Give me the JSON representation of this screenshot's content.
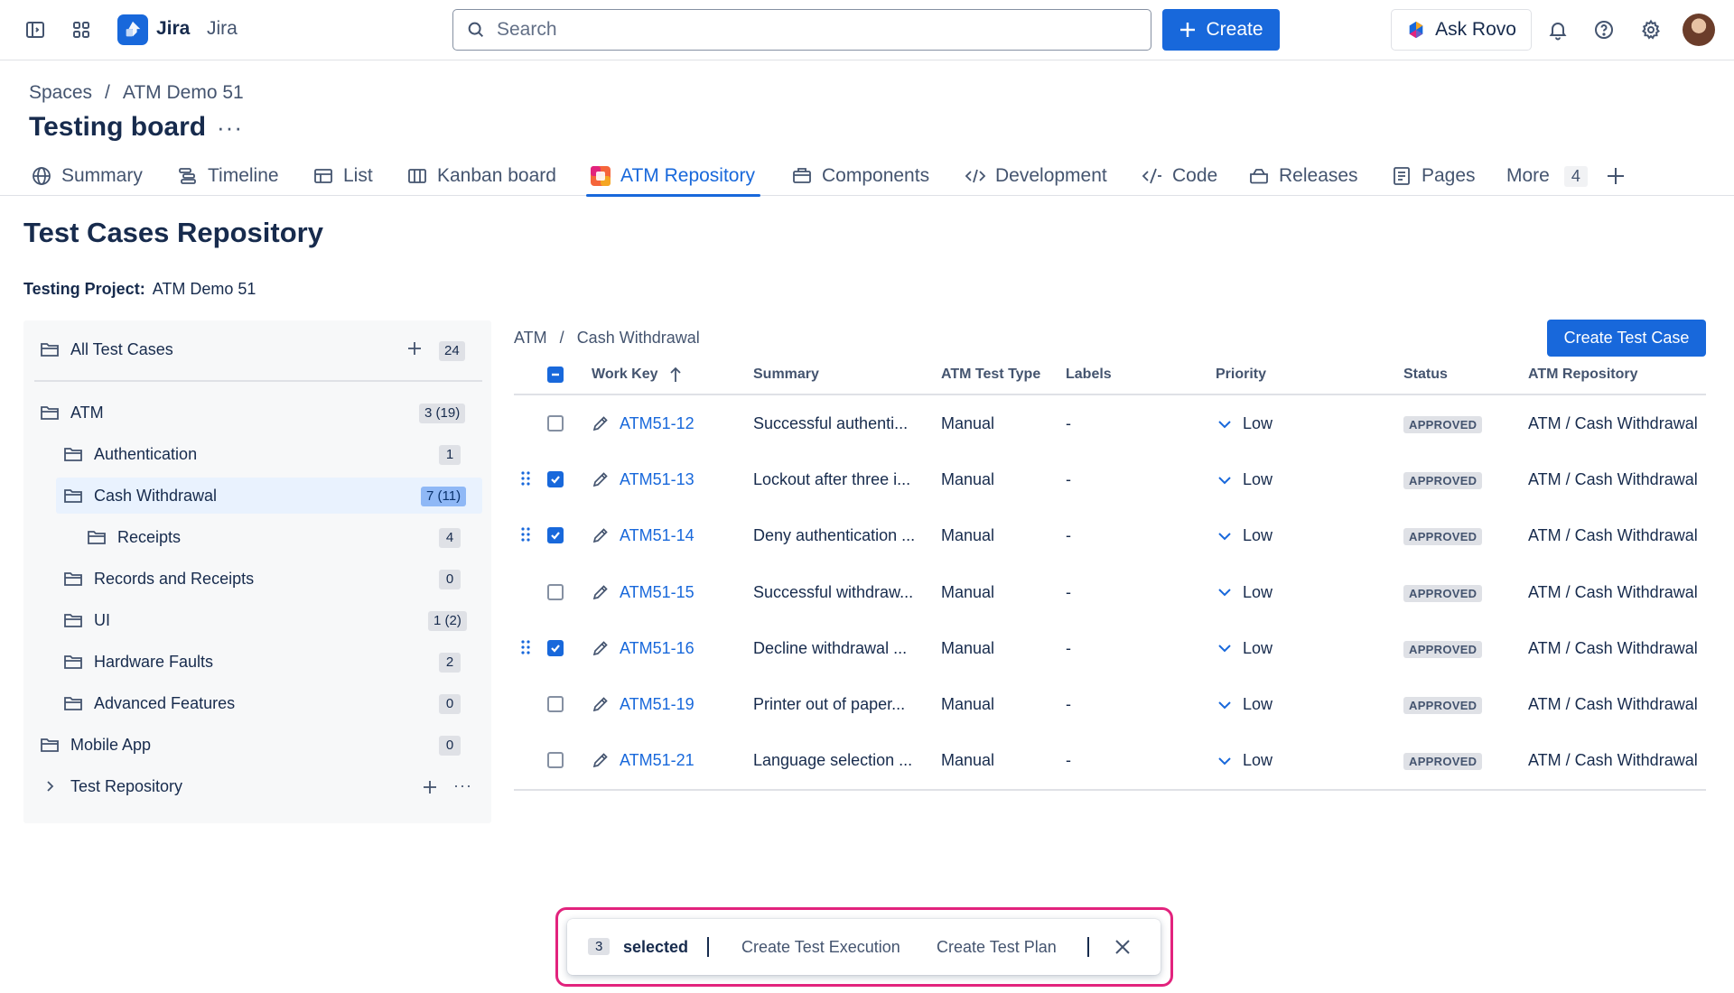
{
  "app": {
    "name": "Jira",
    "workspace": "Jira"
  },
  "search": {
    "placeholder": "Search"
  },
  "topbar": {
    "create_label": "Create",
    "ask_rovo_label": "Ask Rovo"
  },
  "breadcrumb": {
    "items": [
      "Spaces",
      "/",
      "ATM Demo 51"
    ]
  },
  "page": {
    "title": "Testing board",
    "more": "···"
  },
  "tabs": [
    {
      "label": "Summary",
      "icon": "globe-icon"
    },
    {
      "label": "Timeline",
      "icon": "timeline-icon"
    },
    {
      "label": "List",
      "icon": "list-icon"
    },
    {
      "label": "Kanban board",
      "icon": "board-icon"
    },
    {
      "label": "ATM Repository",
      "icon": "atm-app-icon",
      "active": true
    },
    {
      "label": "Components",
      "icon": "components-icon"
    },
    {
      "label": "Development",
      "icon": "development-icon"
    },
    {
      "label": "Code",
      "icon": "code-icon"
    },
    {
      "label": "Releases",
      "icon": "releases-icon"
    },
    {
      "label": "Pages",
      "icon": "pages-icon"
    },
    {
      "label": "More",
      "count": "4"
    }
  ],
  "repository": {
    "title": "Test Cases Repository",
    "project_label": "Testing Project:",
    "project_value": "ATM Demo 51"
  },
  "tree": {
    "all": {
      "label": "All Test Cases",
      "count": "24"
    },
    "items": [
      {
        "label": "ATM",
        "count": "3 (19)"
      },
      {
        "label": "Authentication",
        "count": "1"
      },
      {
        "label": "Cash Withdrawal",
        "count": "7 (11)",
        "selected": true
      },
      {
        "label": "Receipts",
        "count": "4"
      },
      {
        "label": "Records and Receipts",
        "count": "0"
      },
      {
        "label": "UI",
        "count": "1 (2)"
      },
      {
        "label": "Hardware Faults",
        "count": "2"
      },
      {
        "label": "Advanced Features",
        "count": "0"
      },
      {
        "label": "Mobile App",
        "count": "0"
      }
    ],
    "test_repository": "Test Repository"
  },
  "table": {
    "breadcrumb": [
      "ATM",
      "/",
      "Cash Withdrawal"
    ],
    "create_button": "Create Test Case",
    "columns": [
      "Work Key",
      "Summary",
      "ATM Test Type",
      "Labels",
      "Priority",
      "Status",
      "ATM Repository"
    ],
    "rows": [
      {
        "key": "ATM51-12",
        "summary": "Successful authenti...",
        "type": "Manual",
        "labels": "-",
        "priority": "Low",
        "status": "APPROVED",
        "repo": "ATM / Cash Withdrawal",
        "checked": false
      },
      {
        "key": "ATM51-13",
        "summary": "Lockout after three i...",
        "type": "Manual",
        "labels": "-",
        "priority": "Low",
        "status": "APPROVED",
        "repo": "ATM / Cash Withdrawal",
        "checked": true
      },
      {
        "key": "ATM51-14",
        "summary": "Deny authentication ...",
        "type": "Manual",
        "labels": "-",
        "priority": "Low",
        "status": "APPROVED",
        "repo": "ATM / Cash Withdrawal",
        "checked": true
      },
      {
        "key": "ATM51-15",
        "summary": "Successful withdraw...",
        "type": "Manual",
        "labels": "-",
        "priority": "Low",
        "status": "APPROVED",
        "repo": "ATM / Cash Withdrawal",
        "checked": false
      },
      {
        "key": "ATM51-16",
        "summary": "Decline withdrawal ...",
        "type": "Manual",
        "labels": "-",
        "priority": "Low",
        "status": "APPROVED",
        "repo": "ATM / Cash Withdrawal",
        "checked": true
      },
      {
        "key": "ATM51-19",
        "summary": "Printer out of paper...",
        "type": "Manual",
        "labels": "-",
        "priority": "Low",
        "status": "APPROVED",
        "repo": "ATM / Cash Withdrawal",
        "checked": false
      },
      {
        "key": "ATM51-21",
        "summary": "Language selection ...",
        "type": "Manual",
        "labels": "-",
        "priority": "Low",
        "status": "APPROVED",
        "repo": "ATM / Cash Withdrawal",
        "checked": false
      }
    ]
  },
  "bulk_bar": {
    "count": "3",
    "selected_label": "selected",
    "actions": [
      "Create Test Execution",
      "Create Test Plan"
    ]
  },
  "colors": {
    "accent": "#1868db",
    "highlight_outline": "#e2237d",
    "selected_row": "#e9f2fe"
  }
}
